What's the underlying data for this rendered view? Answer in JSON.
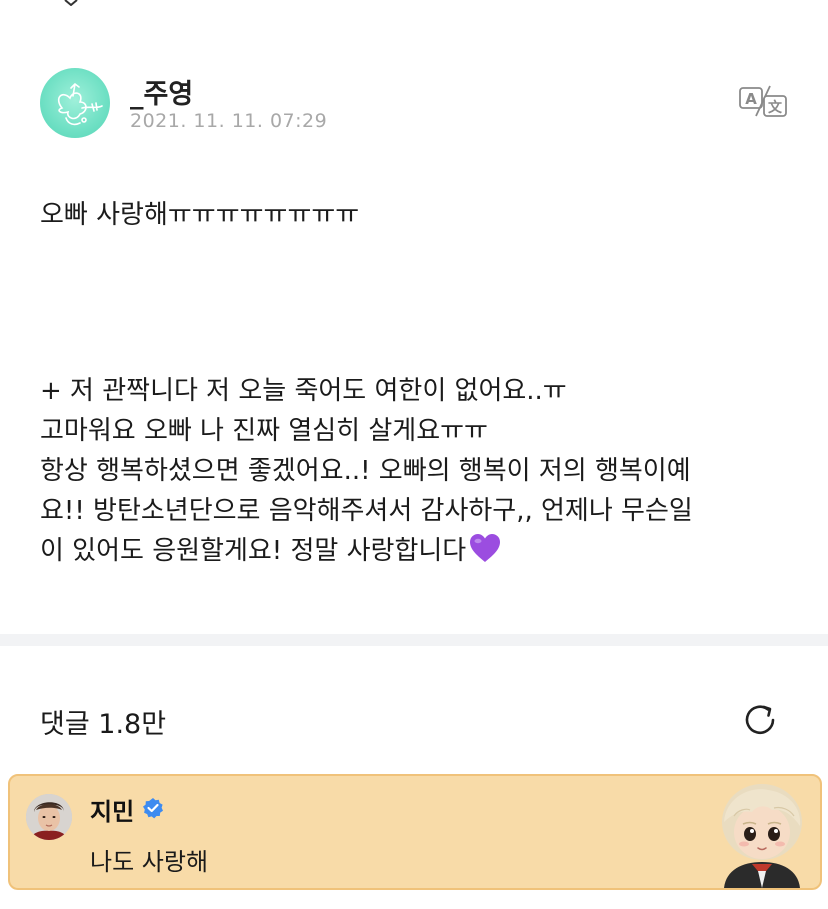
{
  "post": {
    "author": "_주영",
    "timestamp": "2021. 11. 11. 07:29",
    "body_lines_top": [
      "오빠 사랑해ㅠㅠㅠㅠㅠㅠㅠㅠ"
    ],
    "body_lines_bottom": [
      "+ 저 관짝니다 저 오늘 죽어도 여한이 없어요..ㅠ",
      "고마워요 오빠 나 진짜 열심히 살게요ㅠㅠ",
      "항상 행복하셨으면 좋겠어요..! 오빠의 행복이 저의 행복이예",
      "요!! 방탄소년단으로 음악해주셔서 감사하구,, 언제나 무슨일",
      "이 있어도 응원할게요! 정말 사랑합니다"
    ],
    "heart_emoji": "purple-heart-emoji"
  },
  "comments": {
    "label": "댓글 1.8만"
  },
  "comment": {
    "author": "지민",
    "text": "나도 사랑해",
    "verified_color": "#3d8bf0",
    "highlight_bg": "#f8dba8"
  },
  "icons": {
    "translate": "translate-icon",
    "refresh": "refresh-icon",
    "verified": "verified-badge-icon"
  }
}
